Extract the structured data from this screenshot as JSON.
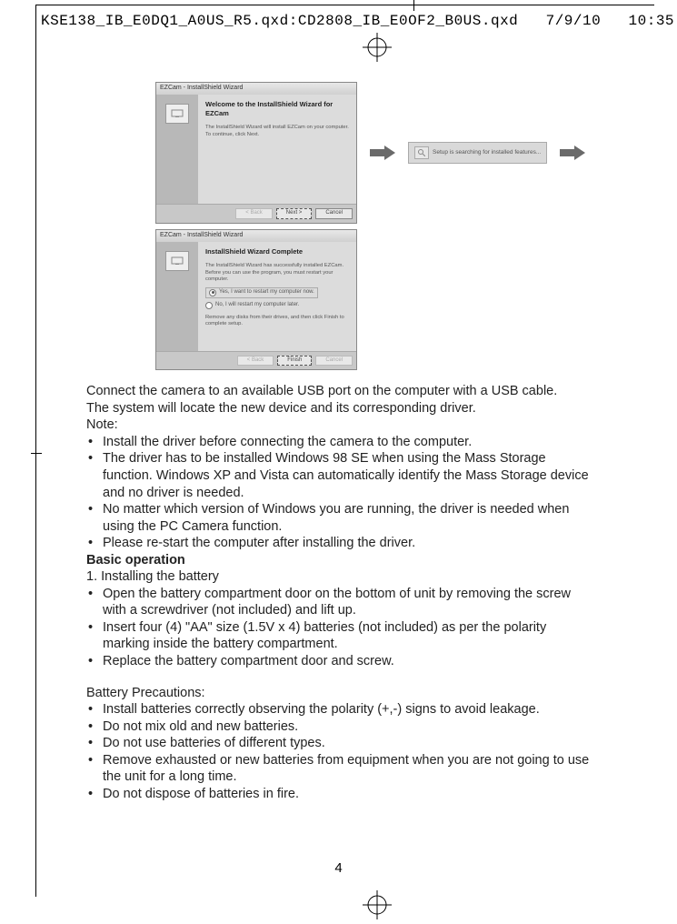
{
  "header": {
    "filename": "KSE138_IB_E0DQ1_A0US_R5.qxd:CD2808_IB_E0OF2_B0US.qxd",
    "date": "7/9/10",
    "time": "10:35"
  },
  "wizard1": {
    "title": "EZCam - InstallShield Wizard",
    "heading": "Welcome to the InstallShield Wizard for EZCam",
    "body": "The InstallShield Wizard will install EZCam on your computer. To continue, click Next.",
    "btn_back": "< Back",
    "btn_next": "Next >",
    "btn_cancel": "Cancel"
  },
  "searching": {
    "text": "Setup is searching for installed features..."
  },
  "wizard2": {
    "title": "EZCam - InstallShield Wizard",
    "heading": "InstallShield Wizard Complete",
    "body1": "The InstallShield Wizard has successfully installed EZCam. Before you can use the program, you must restart your computer.",
    "radio_yes": "Yes, I want to restart my computer now.",
    "radio_no": "No, I will restart my computer later.",
    "body2": "Remove any disks from their drives, and then click Finish to complete setup.",
    "btn_back": "< Back",
    "btn_finish": "Finish",
    "btn_cancel": "Cancel"
  },
  "doc": {
    "p1": "Connect the camera to an available USB port on the computer with a USB cable.",
    "p2": "The system will locate the new device and its corresponding driver.",
    "note_label": "Note:",
    "notes": [
      "Install the driver before connecting the camera to the computer.",
      "The driver has to be installed Windows 98 SE when using the Mass Storage function. Windows XP and Vista can automatically identify the Mass Storage device and no driver is needed.",
      "No matter which version of Windows you are running, the driver is needed when using the PC Camera function.",
      "Please re-start the computer after installing the driver."
    ],
    "basic_op_head": "Basic operation",
    "step1_head": "1. Installing the battery",
    "step1_items": [
      "Open the battery compartment door on the bottom of unit by removing the screw with a screwdriver (not included) and lift up.",
      "Insert four (4) \"AA\" size (1.5V x 4) batteries (not included) as per the polarity marking inside the battery compartment.",
      "Replace the battery compartment door and screw."
    ],
    "precautions_head": "Battery Precautions:",
    "precautions": [
      "Install batteries correctly observing the polarity (+,-) signs to avoid leakage.",
      "Do not mix old and new batteries.",
      "Do not use batteries of different types.",
      "Remove exhausted or new batteries from equipment when you are not going to use the unit for a long time.",
      "Do not dispose of batteries in fire."
    ],
    "page_number": "4"
  }
}
